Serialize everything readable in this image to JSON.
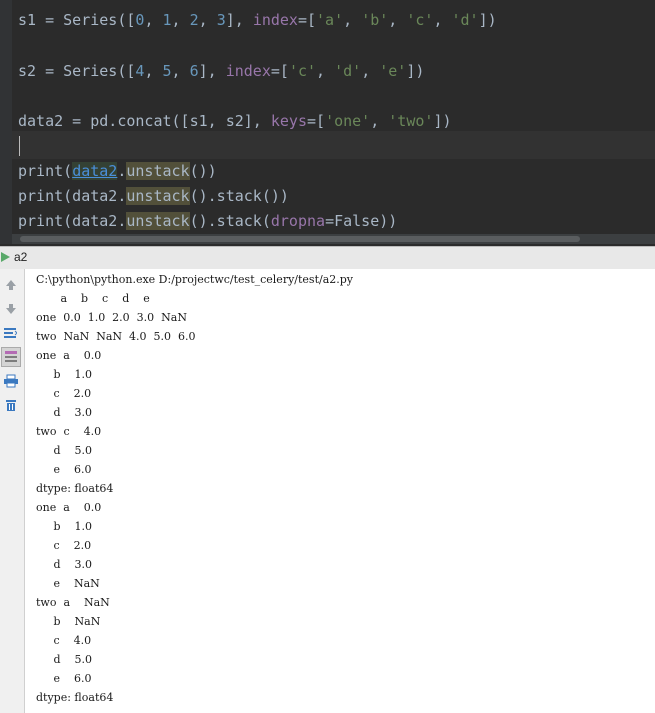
{
  "editor": {
    "line1": {
      "a": "s1 = Series([",
      "n0": "0",
      "c1": ", ",
      "n1": "1",
      "c2": ", ",
      "n2": "2",
      "c3": ", ",
      "n3": "3",
      "b": "], ",
      "kw": "index",
      "eq": "=[",
      "s1": "'a'",
      "c4": ", ",
      "s2": "'b'",
      "c5": ", ",
      "s3": "'c'",
      "c6": ", ",
      "s4": "'d'",
      "end": "])"
    },
    "line2": {
      "a": "s2 = Series([",
      "n0": "4",
      "c1": ", ",
      "n1": "5",
      "c2": ", ",
      "n2": "6",
      "b": "], ",
      "kw": "index",
      "eq": "=[",
      "s1": "'c'",
      "c4": ", ",
      "s2": "'d'",
      "c5": ", ",
      "s3": "'e'",
      "end": "])"
    },
    "line3": {
      "a": "data2 = pd.concat([s1, s2], ",
      "kw": "keys",
      "eq": "=[",
      "s1": "'one'",
      "c": ", ",
      "s2": "'two'",
      "end": "])"
    },
    "line4": {
      "a": "print(",
      "var": "data2",
      "dot": ".",
      "fn": "unstack",
      "end": "())"
    },
    "line5": {
      "a": "print(data2.",
      "fn": "unstack",
      "end": "().stack())"
    },
    "line6": {
      "a": "print(data2.",
      "fn": "unstack",
      "mid": "().stack(",
      "kw": "dropna",
      "end": "=False))"
    }
  },
  "run": {
    "tab_label": "a2",
    "console_lines": [
      "C:\\python\\python.exe D:/projectwc/test_celery/test/a2.py",
      "       a    b    c    d    e",
      "one  0.0  1.0  2.0  3.0  NaN",
      "two  NaN  NaN  4.0  5.0  6.0",
      "one  a    0.0",
      "     b    1.0",
      "     c    2.0",
      "     d    3.0",
      "two  c    4.0",
      "     d    5.0",
      "     e    6.0",
      "dtype: float64",
      "one  a    0.0",
      "     b    1.0",
      "     c    2.0",
      "     d    3.0",
      "     e    NaN",
      "two  a    NaN",
      "     b    NaN",
      "     c    4.0",
      "     d    5.0",
      "     e    6.0",
      "dtype: float64"
    ],
    "toolbar_icons": [
      "rerun-up-icon",
      "down-arrow-icon",
      "soft-wrap-icon",
      "scroll-to-end-icon",
      "print-icon",
      "trash-icon"
    ]
  }
}
